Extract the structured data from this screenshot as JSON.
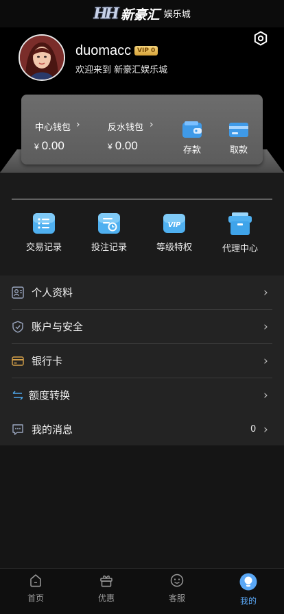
{
  "header": {
    "logo_mark": "HH",
    "brand": "新豪汇",
    "brand_sub": "娱乐城"
  },
  "profile": {
    "username": "duomacc",
    "vip_badge": "VIP 0",
    "welcome": "欢迎来到 新豪汇娱乐城"
  },
  "wallet": {
    "main": {
      "label": "中心钱包",
      "currency": "¥",
      "amount": "0.00"
    },
    "rebate": {
      "label": "反水钱包",
      "currency": "¥",
      "amount": "0.00"
    },
    "deposit_label": "存款",
    "withdraw_label": "取款"
  },
  "shortcuts": [
    {
      "label": "交易记录",
      "icon": "transaction-record-icon"
    },
    {
      "label": "投注记录",
      "icon": "bet-record-icon"
    },
    {
      "label": "等级特权",
      "icon": "vip-privilege-icon"
    },
    {
      "label": "代理中心",
      "icon": "agent-center-icon"
    }
  ],
  "menu": [
    {
      "label": "个人资料",
      "icon": "profile-card-icon"
    },
    {
      "label": "账户与安全",
      "icon": "shield-icon"
    },
    {
      "label": "银行卡",
      "icon": "bank-card-icon"
    },
    {
      "label": "额度转换",
      "icon": "transfer-arrows-icon"
    },
    {
      "label": "我的消息",
      "icon": "message-icon",
      "count": "0"
    }
  ],
  "tabs": [
    {
      "label": "首页",
      "icon": "home-icon"
    },
    {
      "label": "优惠",
      "icon": "gift-icon"
    },
    {
      "label": "客服",
      "icon": "customer-service-icon"
    },
    {
      "label": "我的",
      "icon": "my-profile-icon",
      "active": true
    }
  ],
  "colors": {
    "accent": "#5aa7f5",
    "vip_gold": "#e0b04a",
    "background": "#151515"
  }
}
